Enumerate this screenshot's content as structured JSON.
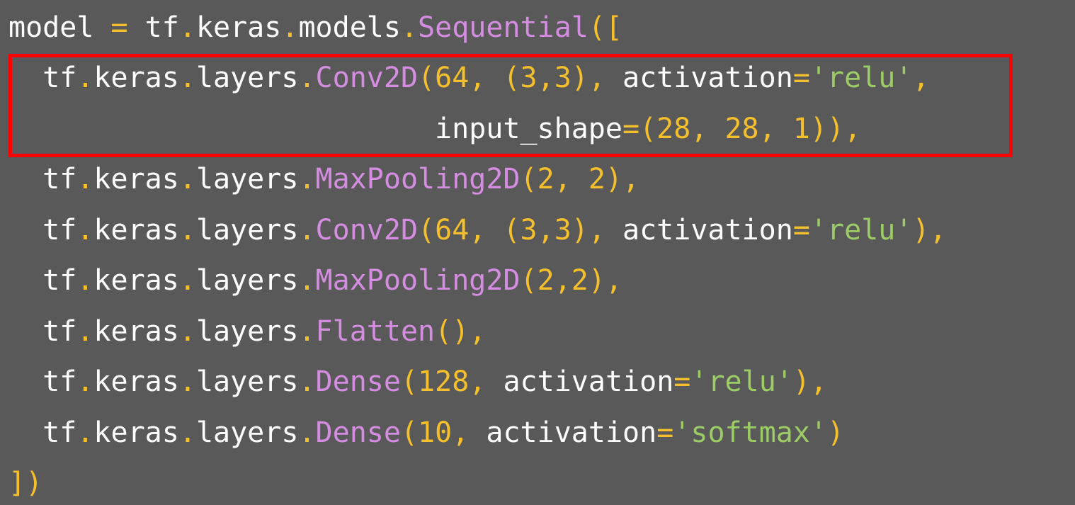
{
  "colors": {
    "background": "#595959",
    "plain": "#ffffff",
    "punctuation": "#f5c02b",
    "function": "#d48de0",
    "string": "#9ccc65",
    "highlight": "#ff0000"
  },
  "code": {
    "lines": [
      {
        "tokens": [
          {
            "t": "model ",
            "k": "plain"
          },
          {
            "t": "=",
            "k": "op"
          },
          {
            "t": " tf",
            "k": "plain"
          },
          {
            "t": ".",
            "k": "punct"
          },
          {
            "t": "keras",
            "k": "plain"
          },
          {
            "t": ".",
            "k": "punct"
          },
          {
            "t": "models",
            "k": "plain"
          },
          {
            "t": ".",
            "k": "punct"
          },
          {
            "t": "Sequential",
            "k": "func"
          },
          {
            "t": "([",
            "k": "punct"
          }
        ]
      },
      {
        "tokens": [
          {
            "t": "  tf",
            "k": "plain"
          },
          {
            "t": ".",
            "k": "punct"
          },
          {
            "t": "keras",
            "k": "plain"
          },
          {
            "t": ".",
            "k": "punct"
          },
          {
            "t": "layers",
            "k": "plain"
          },
          {
            "t": ".",
            "k": "punct"
          },
          {
            "t": "Conv2D",
            "k": "func"
          },
          {
            "t": "(64, (3,3),",
            "k": "punct"
          },
          {
            "t": " activation",
            "k": "plain"
          },
          {
            "t": "=",
            "k": "op"
          },
          {
            "t": "'relu'",
            "k": "str"
          },
          {
            "t": ",",
            "k": "punct"
          }
        ]
      },
      {
        "tokens": [
          {
            "t": "                         input_shape",
            "k": "plain"
          },
          {
            "t": "=(28, 28, 1)),",
            "k": "punct"
          }
        ]
      },
      {
        "tokens": [
          {
            "t": "  tf",
            "k": "plain"
          },
          {
            "t": ".",
            "k": "punct"
          },
          {
            "t": "keras",
            "k": "plain"
          },
          {
            "t": ".",
            "k": "punct"
          },
          {
            "t": "layers",
            "k": "plain"
          },
          {
            "t": ".",
            "k": "punct"
          },
          {
            "t": "MaxPooling2D",
            "k": "func"
          },
          {
            "t": "(2, 2),",
            "k": "punct"
          }
        ]
      },
      {
        "tokens": [
          {
            "t": "  tf",
            "k": "plain"
          },
          {
            "t": ".",
            "k": "punct"
          },
          {
            "t": "keras",
            "k": "plain"
          },
          {
            "t": ".",
            "k": "punct"
          },
          {
            "t": "layers",
            "k": "plain"
          },
          {
            "t": ".",
            "k": "punct"
          },
          {
            "t": "Conv2D",
            "k": "func"
          },
          {
            "t": "(64, (3,3),",
            "k": "punct"
          },
          {
            "t": " activation",
            "k": "plain"
          },
          {
            "t": "=",
            "k": "op"
          },
          {
            "t": "'relu'",
            "k": "str"
          },
          {
            "t": "),",
            "k": "punct"
          }
        ]
      },
      {
        "tokens": [
          {
            "t": "  tf",
            "k": "plain"
          },
          {
            "t": ".",
            "k": "punct"
          },
          {
            "t": "keras",
            "k": "plain"
          },
          {
            "t": ".",
            "k": "punct"
          },
          {
            "t": "layers",
            "k": "plain"
          },
          {
            "t": ".",
            "k": "punct"
          },
          {
            "t": "MaxPooling2D",
            "k": "func"
          },
          {
            "t": "(2,2),",
            "k": "punct"
          }
        ]
      },
      {
        "tokens": [
          {
            "t": "  tf",
            "k": "plain"
          },
          {
            "t": ".",
            "k": "punct"
          },
          {
            "t": "keras",
            "k": "plain"
          },
          {
            "t": ".",
            "k": "punct"
          },
          {
            "t": "layers",
            "k": "plain"
          },
          {
            "t": ".",
            "k": "punct"
          },
          {
            "t": "Flatten",
            "k": "func"
          },
          {
            "t": "(),",
            "k": "punct"
          }
        ]
      },
      {
        "tokens": [
          {
            "t": "  tf",
            "k": "plain"
          },
          {
            "t": ".",
            "k": "punct"
          },
          {
            "t": "keras",
            "k": "plain"
          },
          {
            "t": ".",
            "k": "punct"
          },
          {
            "t": "layers",
            "k": "plain"
          },
          {
            "t": ".",
            "k": "punct"
          },
          {
            "t": "Dense",
            "k": "func"
          },
          {
            "t": "(128,",
            "k": "punct"
          },
          {
            "t": " activation",
            "k": "plain"
          },
          {
            "t": "=",
            "k": "op"
          },
          {
            "t": "'relu'",
            "k": "str"
          },
          {
            "t": "),",
            "k": "punct"
          }
        ]
      },
      {
        "tokens": [
          {
            "t": "  tf",
            "k": "plain"
          },
          {
            "t": ".",
            "k": "punct"
          },
          {
            "t": "keras",
            "k": "plain"
          },
          {
            "t": ".",
            "k": "punct"
          },
          {
            "t": "layers",
            "k": "plain"
          },
          {
            "t": ".",
            "k": "punct"
          },
          {
            "t": "Dense",
            "k": "func"
          },
          {
            "t": "(10,",
            "k": "punct"
          },
          {
            "t": " activation",
            "k": "plain"
          },
          {
            "t": "=",
            "k": "op"
          },
          {
            "t": "'softmax'",
            "k": "str"
          },
          {
            "t": ")",
            "k": "punct"
          }
        ]
      },
      {
        "tokens": [
          {
            "t": "])",
            "k": "punct"
          }
        ]
      }
    ]
  }
}
